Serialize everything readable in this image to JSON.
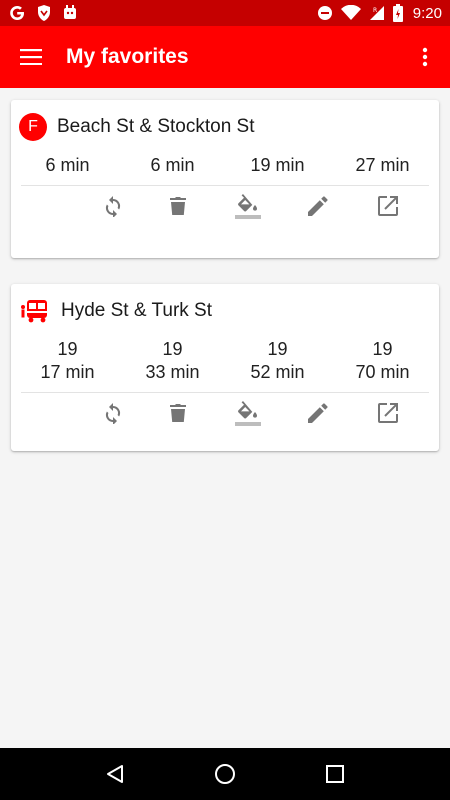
{
  "status_bar": {
    "time": "9:20",
    "icons": [
      "google-icon",
      "shield-icon",
      "android-icon",
      "do-not-disturb-icon",
      "wifi-icon",
      "signal-icon",
      "battery-charging-icon"
    ]
  },
  "app_bar": {
    "title": "My favorites"
  },
  "colors": {
    "primary": "#ff0000",
    "status_bar": "#c50000",
    "icon_gray": "#757575",
    "background": "#f5f5f5"
  },
  "favorites": [
    {
      "badge": "F",
      "stop": "Beach St & Stockton St",
      "times": [
        {
          "route": "",
          "eta": "6 min"
        },
        {
          "route": "",
          "eta": "6 min"
        },
        {
          "route": "",
          "eta": "19 min"
        },
        {
          "route": "",
          "eta": "27 min"
        }
      ],
      "actions": [
        "refresh-icon",
        "delete-icon",
        "color-fill-icon",
        "edit-icon",
        "open-external-icon"
      ]
    },
    {
      "badge_icon": "bus-icon",
      "stop": "Hyde St & Turk St",
      "times": [
        {
          "route": "19",
          "eta": "17 min"
        },
        {
          "route": "19",
          "eta": "33 min"
        },
        {
          "route": "19",
          "eta": "52 min"
        },
        {
          "route": "19",
          "eta": "70 min"
        }
      ],
      "actions": [
        "refresh-icon",
        "delete-icon",
        "color-fill-icon",
        "edit-icon",
        "open-external-icon"
      ]
    }
  ],
  "nav_bar": [
    "back-icon",
    "home-icon",
    "recents-icon"
  ]
}
